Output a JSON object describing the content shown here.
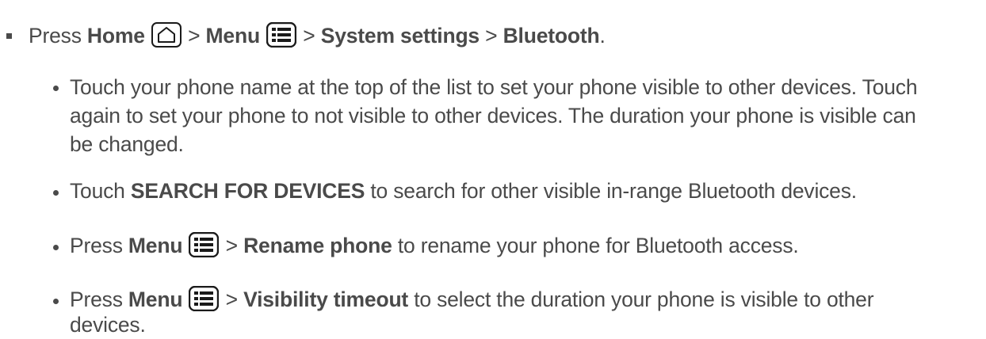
{
  "main_step": {
    "press": "Press",
    "home": "Home",
    "sep1": ">",
    "menu": "Menu",
    "sep2": ">",
    "system_settings": "System settings",
    "sep3": ">",
    "bluetooth": "Bluetooth",
    "period": "."
  },
  "bullet1": {
    "line1": "Touch your phone name at the top of the list to set your phone visible to other devices. Touch",
    "line2": "again to set your phone to not visible to other devices. The duration your phone is visible can",
    "line3": "be changed."
  },
  "bullet2": {
    "touch": "Touch",
    "search": "SEARCH FOR DEVICES",
    "rest": "to search for other visible in-range Bluetooth devices."
  },
  "bullet3": {
    "press": "Press",
    "menu": "Menu",
    "sep": ">",
    "rename": "Rename phone",
    "rest": "to rename your phone for Bluetooth access."
  },
  "bullet4": {
    "press": "Press",
    "menu": "Menu",
    "sep": ">",
    "visibility": "Visibility timeout",
    "rest_line1": "to select the duration your phone is visible to other",
    "rest_line2": "devices."
  },
  "icons": {
    "home": "home-key-icon",
    "menu": "menu-key-icon"
  },
  "colors": {
    "text": "#4a4a4a",
    "icon_stroke": "#1a1a1a"
  }
}
